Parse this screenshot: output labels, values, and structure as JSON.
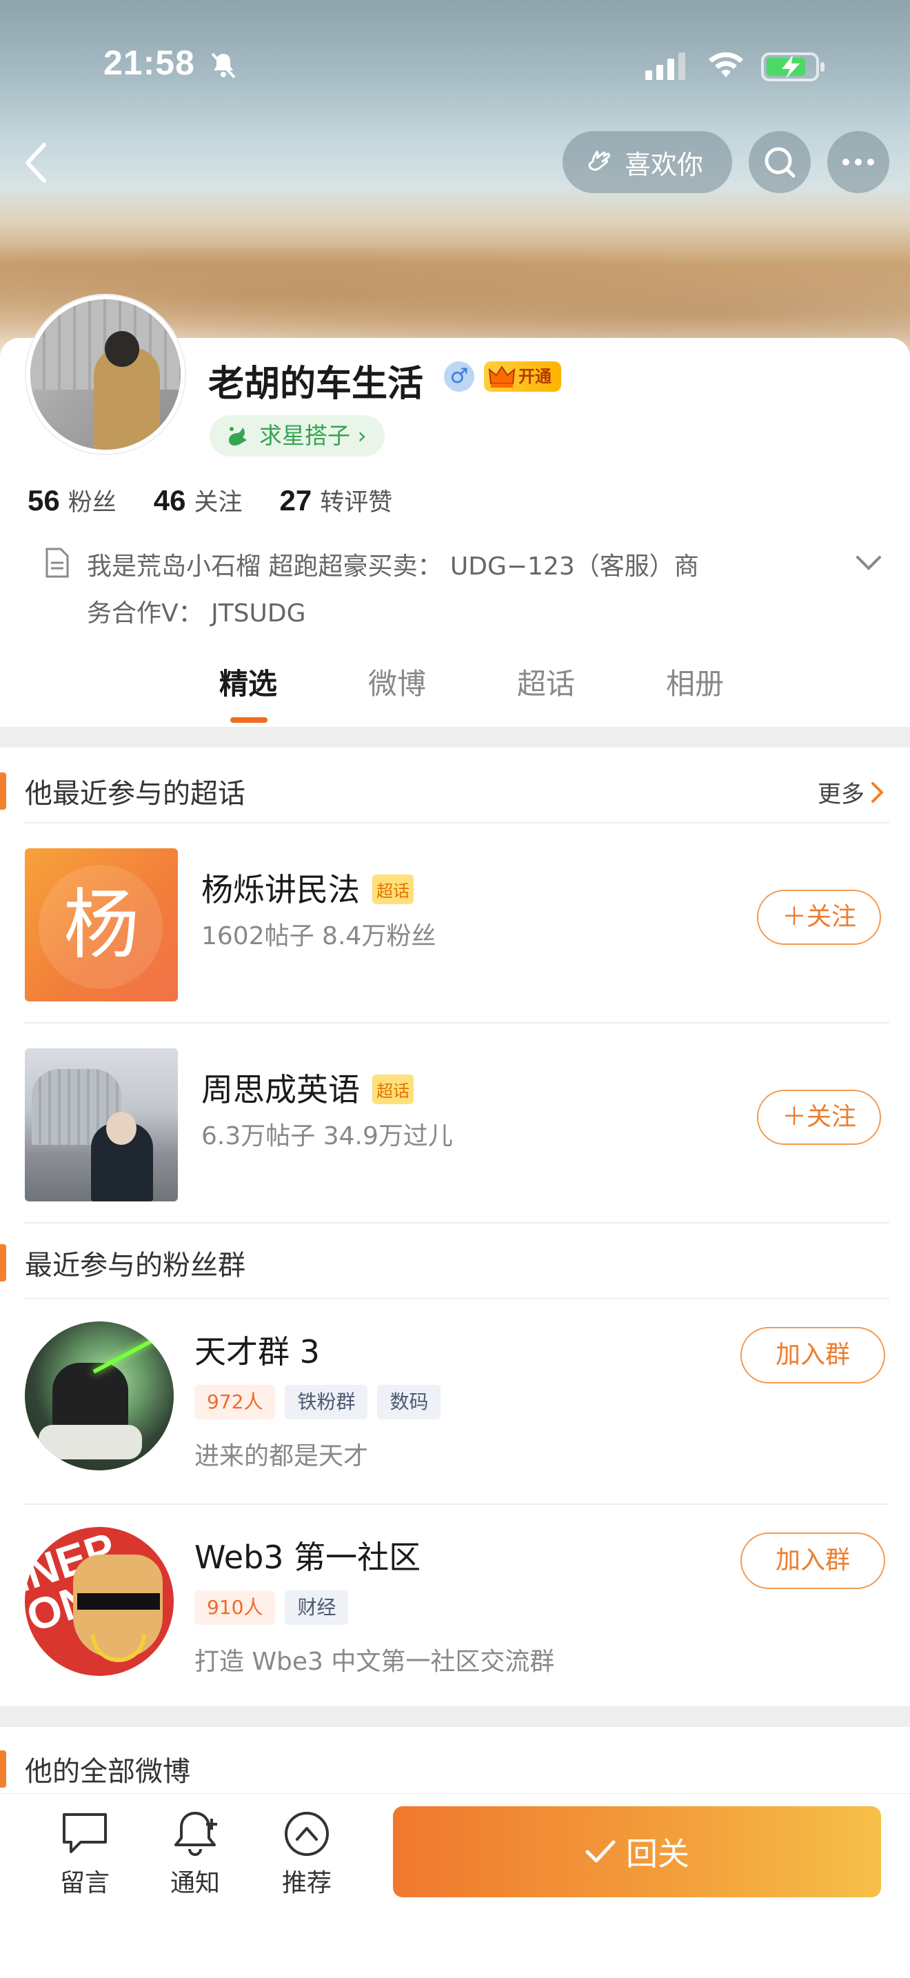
{
  "status_bar": {
    "time": "21:58"
  },
  "header": {
    "like_label": "喜欢你"
  },
  "profile": {
    "name": "老胡的车生活",
    "gender_symbol": "♂",
    "vip_label": "开通",
    "star_pill": "求星搭子",
    "stats": [
      {
        "value": "56",
        "label": "粉丝"
      },
      {
        "value": "46",
        "label": "关注"
      },
      {
        "value": "27",
        "label": "转评赞"
      }
    ],
    "bio_line1": "我是荒岛小石榴 超跑超豪买卖： UDG−123（客服）商",
    "bio_line2": "务合作V： JTSUDG"
  },
  "tabs": [
    "精选",
    "微博",
    "超话",
    "相册"
  ],
  "supertopics": {
    "title": "他最近参与的超话",
    "more": "更多",
    "items": [
      {
        "name": "杨烁讲民法",
        "tag": "超话",
        "meta": "1602帖子 8.4万粉丝",
        "follow": "＋关注",
        "thumb_char": "杨"
      },
      {
        "name": "周思成英语",
        "tag": "超话",
        "meta": "6.3万帖子 34.9万过儿",
        "follow": "＋关注"
      }
    ]
  },
  "fan_groups": {
    "title": "最近参与的粉丝群",
    "items": [
      {
        "name": "天才群 3",
        "chips": [
          "972人",
          "铁粉群",
          "数码"
        ],
        "desc": "进来的都是天才",
        "join": "加入群"
      },
      {
        "name": "Web3 第一社区",
        "chips": [
          "910人",
          "财经"
        ],
        "desc": "打造 Wbe3 中文第一社区交流群",
        "join": "加入群",
        "avatar_text": "INEP ON W"
      }
    ]
  },
  "all_weibo": {
    "title": "他的全部微博"
  },
  "bottom_bar": {
    "items": [
      {
        "label": "留言",
        "icon": "comment-icon"
      },
      {
        "label": "通知",
        "icon": "bell-plus-icon"
      },
      {
        "label": "推荐",
        "icon": "up-circle-icon"
      }
    ],
    "reply_label": "回关"
  },
  "colors": {
    "accent": "#f26b22",
    "reply_gradient_start": "#f0782e",
    "reply_gradient_end": "#f6c048"
  }
}
